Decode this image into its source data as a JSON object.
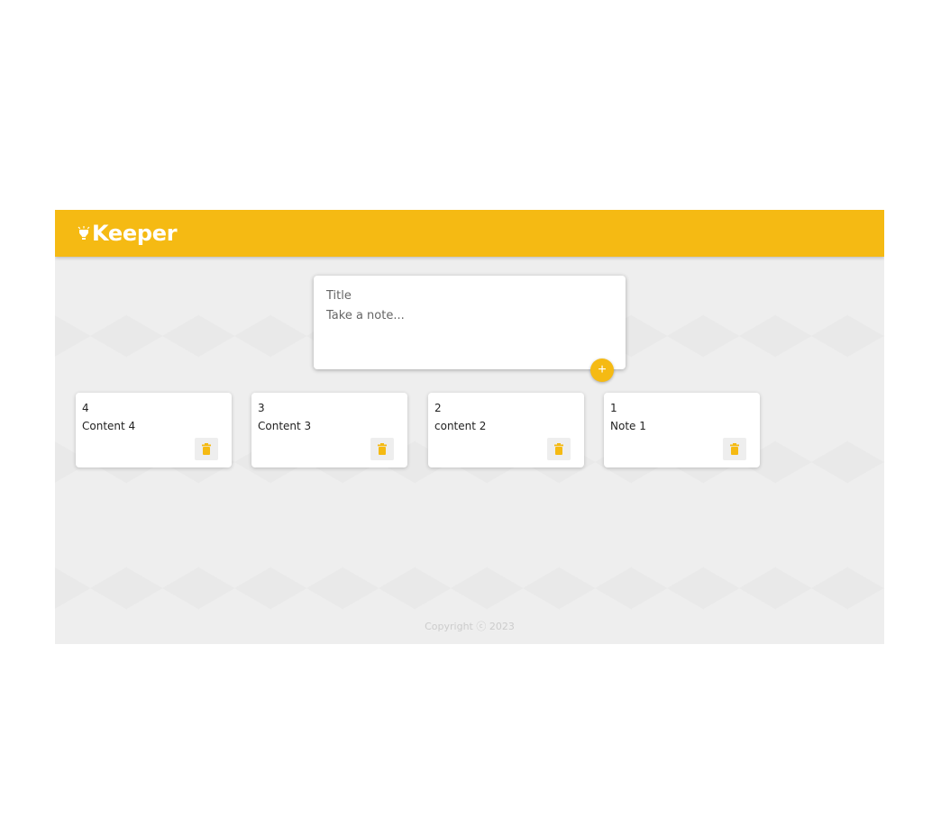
{
  "header": {
    "logo_text": "Keeper",
    "logo_icon": "lightbulb-icon"
  },
  "create_area": {
    "title_placeholder": "Title",
    "content_placeholder": "Take a note...",
    "add_label": "+"
  },
  "notes": [
    {
      "title": "4",
      "content": "Content 4"
    },
    {
      "title": "3",
      "content": "Content 3"
    },
    {
      "title": "2",
      "content": "content 2"
    },
    {
      "title": "1",
      "content": "Note 1"
    }
  ],
  "footer": {
    "text": "Copyright ⓒ 2023"
  },
  "colors": {
    "accent": "#f5ba13",
    "background": "#eeeeee"
  }
}
